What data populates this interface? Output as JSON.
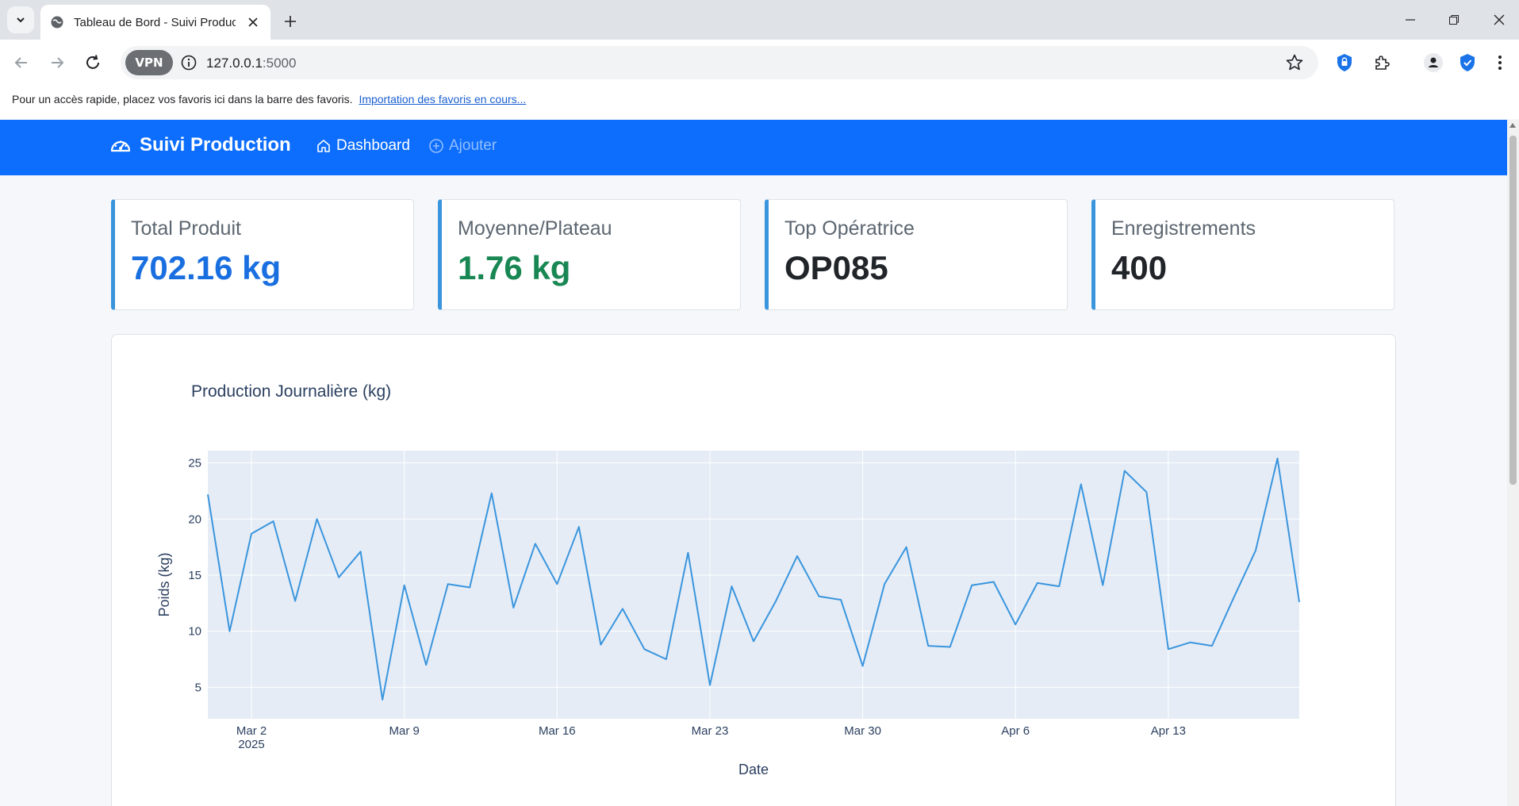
{
  "browser": {
    "tab_title": "Tableau de Bord - Suivi Production",
    "url_host": "127.0.0.1",
    "url_port": ":5000",
    "vpn_label": "VPN",
    "bookmarks_text": "Pour un accès rapide, placez vos favoris ici dans la barre des favoris.",
    "bookmarks_link": "Importation des favoris en cours..."
  },
  "navbar": {
    "brand": "Suivi Production",
    "links": [
      {
        "label": "Dashboard",
        "active": true
      },
      {
        "label": "Ajouter",
        "active": false
      }
    ]
  },
  "stats": [
    {
      "title": "Total Produit",
      "value": "702.16 kg",
      "color": "#1a6fe0"
    },
    {
      "title": "Moyenne/Plateau",
      "value": "1.76 kg",
      "color": "#198754"
    },
    {
      "title": "Top Opératrice",
      "value": "OP085",
      "color": "#212529"
    },
    {
      "title": "Enregistrements",
      "value": "400",
      "color": "#212529"
    }
  ],
  "chart_data": {
    "type": "line",
    "title": "Production Journalière (kg)",
    "xlabel": "Date",
    "ylabel": "Poids (kg)",
    "x_tick_labels": [
      "Mar 2",
      "Mar 9",
      "Mar 16",
      "Mar 23",
      "Mar 30",
      "Apr 6",
      "Apr 13"
    ],
    "x_tick_year": "2025",
    "y_ticks": [
      5,
      10,
      15,
      20,
      25
    ],
    "ylim": [
      2.2,
      26.1
    ],
    "xlim": [
      "2025-02-28",
      "2025-04-19"
    ],
    "line_color": "#3a95dd",
    "series": [
      {
        "x": [
          "2025-02-28",
          "2025-03-01",
          "2025-03-02",
          "2025-03-03",
          "2025-03-04",
          "2025-03-05",
          "2025-03-06",
          "2025-03-07",
          "2025-03-08",
          "2025-03-09",
          "2025-03-10",
          "2025-03-11",
          "2025-03-12",
          "2025-03-13",
          "2025-03-14",
          "2025-03-15",
          "2025-03-16",
          "2025-03-17",
          "2025-03-18",
          "2025-03-19",
          "2025-03-20",
          "2025-03-21",
          "2025-03-22",
          "2025-03-23",
          "2025-03-24",
          "2025-03-25",
          "2025-03-26",
          "2025-03-27",
          "2025-03-28",
          "2025-03-29",
          "2025-03-30",
          "2025-03-31",
          "2025-04-01",
          "2025-04-02",
          "2025-04-03",
          "2025-04-04",
          "2025-04-05",
          "2025-04-06",
          "2025-04-07",
          "2025-04-08",
          "2025-04-09",
          "2025-04-10",
          "2025-04-11",
          "2025-04-12",
          "2025-04-13",
          "2025-04-14",
          "2025-04-15",
          "2025-04-16",
          "2025-04-17",
          "2025-04-18",
          "2025-04-19"
        ],
        "values": [
          22.2,
          10.0,
          18.7,
          19.8,
          12.7,
          20.0,
          14.8,
          17.1,
          3.9,
          14.1,
          7.0,
          14.2,
          13.9,
          22.3,
          12.1,
          17.8,
          14.2,
          19.3,
          8.8,
          12.0,
          8.4,
          7.5,
          17.0,
          5.2,
          14.0,
          9.1,
          12.6,
          16.7,
          13.1,
          12.8,
          6.9,
          14.2,
          17.5,
          8.7,
          8.6,
          14.1,
          14.4,
          10.6,
          14.3,
          14.0,
          23.1,
          14.1,
          24.3,
          22.4,
          8.4,
          9.0,
          8.7,
          13.0,
          17.2,
          25.4,
          12.6
        ]
      }
    ]
  }
}
